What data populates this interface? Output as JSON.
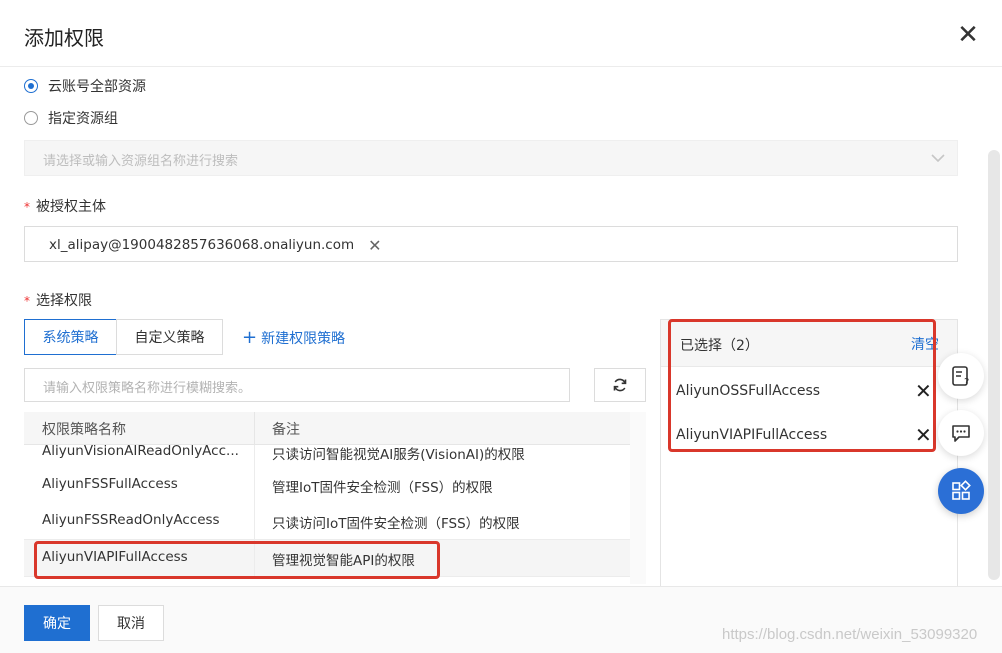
{
  "dialog": {
    "title": "添加权限"
  },
  "scope": {
    "option_all": "云账号全部资源",
    "option_group": "指定资源组",
    "group_placeholder": "请选择或输入资源组名称进行搜索"
  },
  "principal": {
    "label": "被授权主体",
    "value": "xl_alipay@1900482857636068.onaliyun.com"
  },
  "permissions": {
    "label": "选择权限",
    "tabs": [
      "系统策略",
      "自定义策略"
    ],
    "new_policy": "新建权限策略",
    "search_placeholder": "请输入权限策略名称进行模糊搜索。",
    "columns": [
      "权限策略名称",
      "备注"
    ],
    "rows": [
      {
        "name": "AliyunVisionAIReadOnlyAcc...",
        "note": "只读访问智能视觉AI服务(VisionAI)的权限"
      },
      {
        "name": "AliyunFSSFullAccess",
        "note": "管理IoT固件安全检测（FSS）的权限"
      },
      {
        "name": "AliyunFSSReadOnlyAccess",
        "note": "只读访问IoT固件安全检测（FSS）的权限"
      },
      {
        "name": "AliyunVIAPIFullAccess",
        "note": "管理视觉智能API的权限"
      }
    ]
  },
  "selected": {
    "title": "已选择（2）",
    "clear": "清空",
    "items": [
      "AliyunOSSFullAccess",
      "AliyunVIAPIFullAccess"
    ]
  },
  "footer": {
    "ok": "确定",
    "cancel": "取消"
  },
  "watermark": "https://blog.csdn.net/weixin_53099320",
  "colors": {
    "primary": "#1f6fd1",
    "highlight_border": "#d9372b"
  },
  "icons": {
    "close": "close-icon",
    "refresh": "refresh-icon",
    "feedback": "feedback-icon",
    "chat": "chat-icon",
    "apps": "apps-icon"
  }
}
